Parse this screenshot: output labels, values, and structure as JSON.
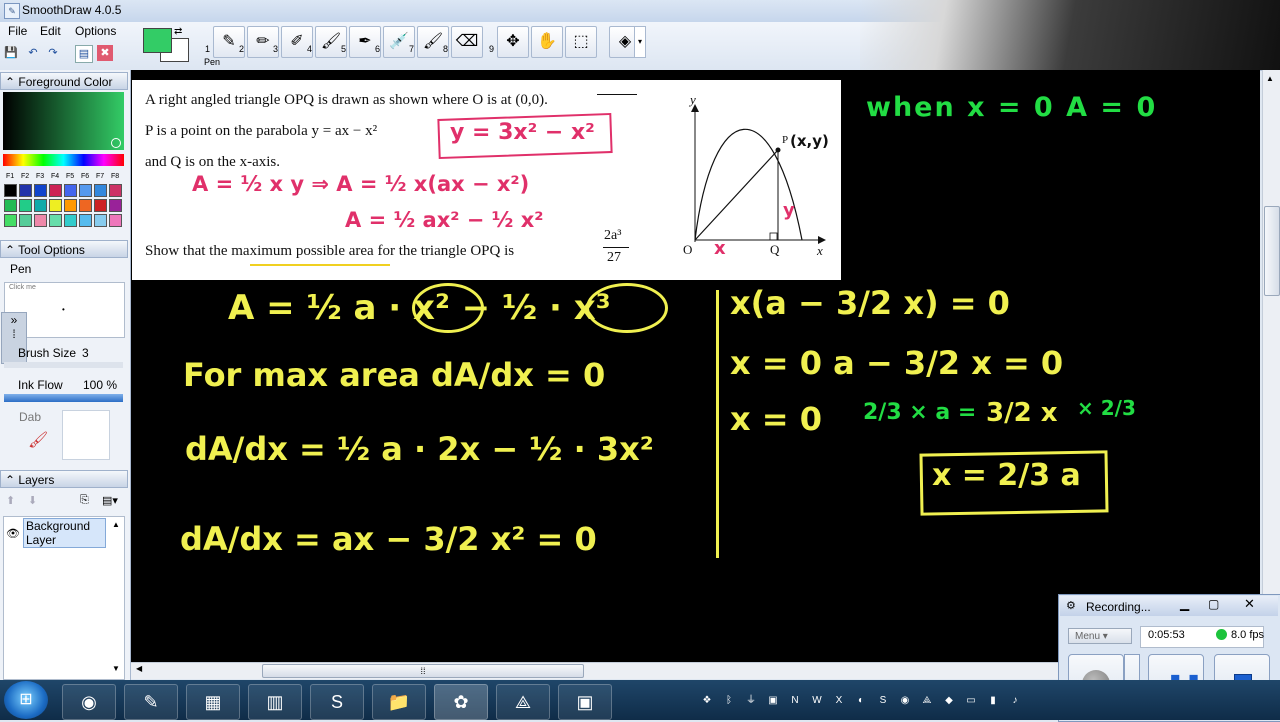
{
  "window": {
    "title": "SmoothDraw 4.0.5"
  },
  "menu": [
    "File",
    "Edit",
    "Options"
  ],
  "toolbar": {
    "tools": [
      {
        "num": "1",
        "name": "pen",
        "glyph": "✎"
      },
      {
        "num": "2",
        "name": "pencil",
        "glyph": "✏"
      },
      {
        "num": "3",
        "name": "highlighter",
        "glyph": "✐"
      },
      {
        "num": "4",
        "name": "brush",
        "glyph": "🖌"
      },
      {
        "num": "5",
        "name": "airbrush",
        "glyph": "✒"
      },
      {
        "num": "6",
        "name": "syringe",
        "glyph": "💉"
      },
      {
        "num": "7",
        "name": "paintbrush",
        "glyph": "🖌"
      },
      {
        "num": "8",
        "name": "eraser",
        "glyph": "⌫"
      },
      {
        "num": "9",
        "name": "move",
        "glyph": "✥"
      },
      {
        "num": "",
        "name": "hand",
        "glyph": "✋"
      },
      {
        "num": "",
        "name": "select",
        "glyph": "⬚"
      },
      {
        "num": "",
        "name": "fill",
        "glyph": "◈"
      }
    ],
    "active_tool_label": "Pen"
  },
  "panels": {
    "foreground": "Foreground Color",
    "fkeys": [
      "F1",
      "F2",
      "F3",
      "F4",
      "F5",
      "F6",
      "F7",
      "F8"
    ],
    "tool_options": "Tool Options",
    "tool_name": "Pen",
    "click_me": "Click me",
    "brush_size_label": "Brush Size",
    "brush_size": "3",
    "ink_flow_label": "Ink Flow",
    "ink_flow": "100 %",
    "dab": "Dab",
    "layers": "Layers",
    "layer_name": "Background Layer"
  },
  "colors": {
    "foreground": "#33cc66",
    "background": "#ffffff"
  },
  "worksheet": {
    "line1": "A right angled triangle OPQ is drawn as shown where O is at (0,0).",
    "line2": "P is a point on the parabola y = ax − x²",
    "line3": "and Q is on the x-axis.",
    "line4": "Show that the maximum possible area for the triangle OPQ is",
    "frac_num": "2a³",
    "frac_den": "27",
    "graph_y": "y",
    "graph_x": "x",
    "graph_o": "O",
    "graph_q": "Q",
    "graph_p": "P"
  },
  "handwriting": {
    "pink": [
      "y = 3x² − x²",
      "A = ½ x y ⇒ A = ½ x(ax − x²)",
      "A = ½ ax² − ½ x²",
      "(x,y)",
      "x",
      "y"
    ],
    "green": [
      "when  x = 0   A = 0",
      "2/3 × a =",
      "× 2/3"
    ],
    "yellow": [
      "A = ½ a · x² − ½ · x³",
      "For max area  dA/dx = 0",
      "dA/dx = ½ a · 2x − ½ · 3x²",
      "dA/dx = ax − 3/2 x² = 0",
      "x(a − 3/2 x) = 0",
      "x = 0     a − 3/2 x = 0",
      "x = 0",
      "3/2 x",
      "x = 2/3 a"
    ]
  },
  "recording": {
    "title": "Recording...",
    "menu": "Menu",
    "time": "0:05:53",
    "fps": "8.0 fps"
  }
}
